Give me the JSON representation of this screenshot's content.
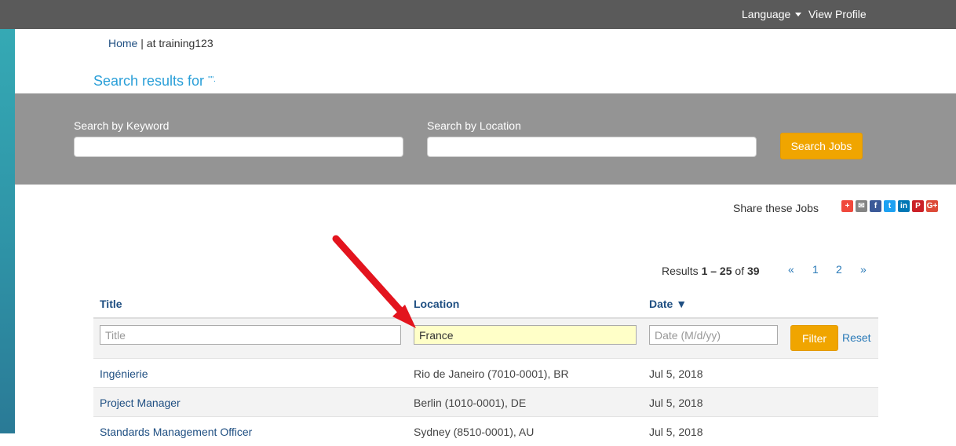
{
  "topbar": {
    "language": "Language",
    "view_profile": "View Profile"
  },
  "breadcrumb": {
    "home": "Home",
    "separator": " | ",
    "current": "at training123"
  },
  "search_title": {
    "text": "Search results for",
    "query": "\"\"."
  },
  "search": {
    "keyword_label": "Search by Keyword",
    "location_label": "Search by Location",
    "keyword_value": "",
    "location_value": "",
    "button": "Search Jobs"
  },
  "share": {
    "label": "Share these Jobs",
    "icons": [
      {
        "name": "addthis-icon",
        "glyph": "+",
        "color": "#f0483c"
      },
      {
        "name": "email-icon",
        "glyph": "✉",
        "color": "#848484"
      },
      {
        "name": "facebook-icon",
        "glyph": "f",
        "color": "#3b5998"
      },
      {
        "name": "twitter-icon",
        "glyph": "t",
        "color": "#1da1f2"
      },
      {
        "name": "linkedin-icon",
        "glyph": "in",
        "color": "#0077b5"
      },
      {
        "name": "pinterest-icon",
        "glyph": "P",
        "color": "#cb2027"
      },
      {
        "name": "googleplus-icon",
        "glyph": "G+",
        "color": "#dd4b39"
      }
    ]
  },
  "results": {
    "prefix": "Results ",
    "range": "1 – 25",
    "of": " of ",
    "total": "39"
  },
  "pagination": {
    "prev": "«",
    "page1": "1",
    "page2": "2",
    "next": "»"
  },
  "table": {
    "headers": {
      "title": "Title",
      "location": "Location",
      "date": "Date ▼"
    },
    "filters": {
      "title_placeholder": "Title",
      "location_value": "France",
      "date_placeholder": "Date (M/d/yy)",
      "filter_button": "Filter",
      "reset": "Reset"
    },
    "rows": [
      {
        "title": "Ingénierie",
        "location": "Rio de Janeiro (7010-0001), BR",
        "date": "Jul 5, 2018"
      },
      {
        "title": "Project Manager",
        "location": "Berlin (1010-0001), DE",
        "date": "Jul 5, 2018"
      },
      {
        "title": "Standards Management Officer",
        "location": "Sydney (8510-0001), AU",
        "date": "Jul 5, 2018"
      }
    ]
  },
  "colors": {
    "accent": "#f0a500",
    "link": "#1f4f82",
    "highlight": "#ffffc8",
    "arrow": "#e3141e"
  }
}
